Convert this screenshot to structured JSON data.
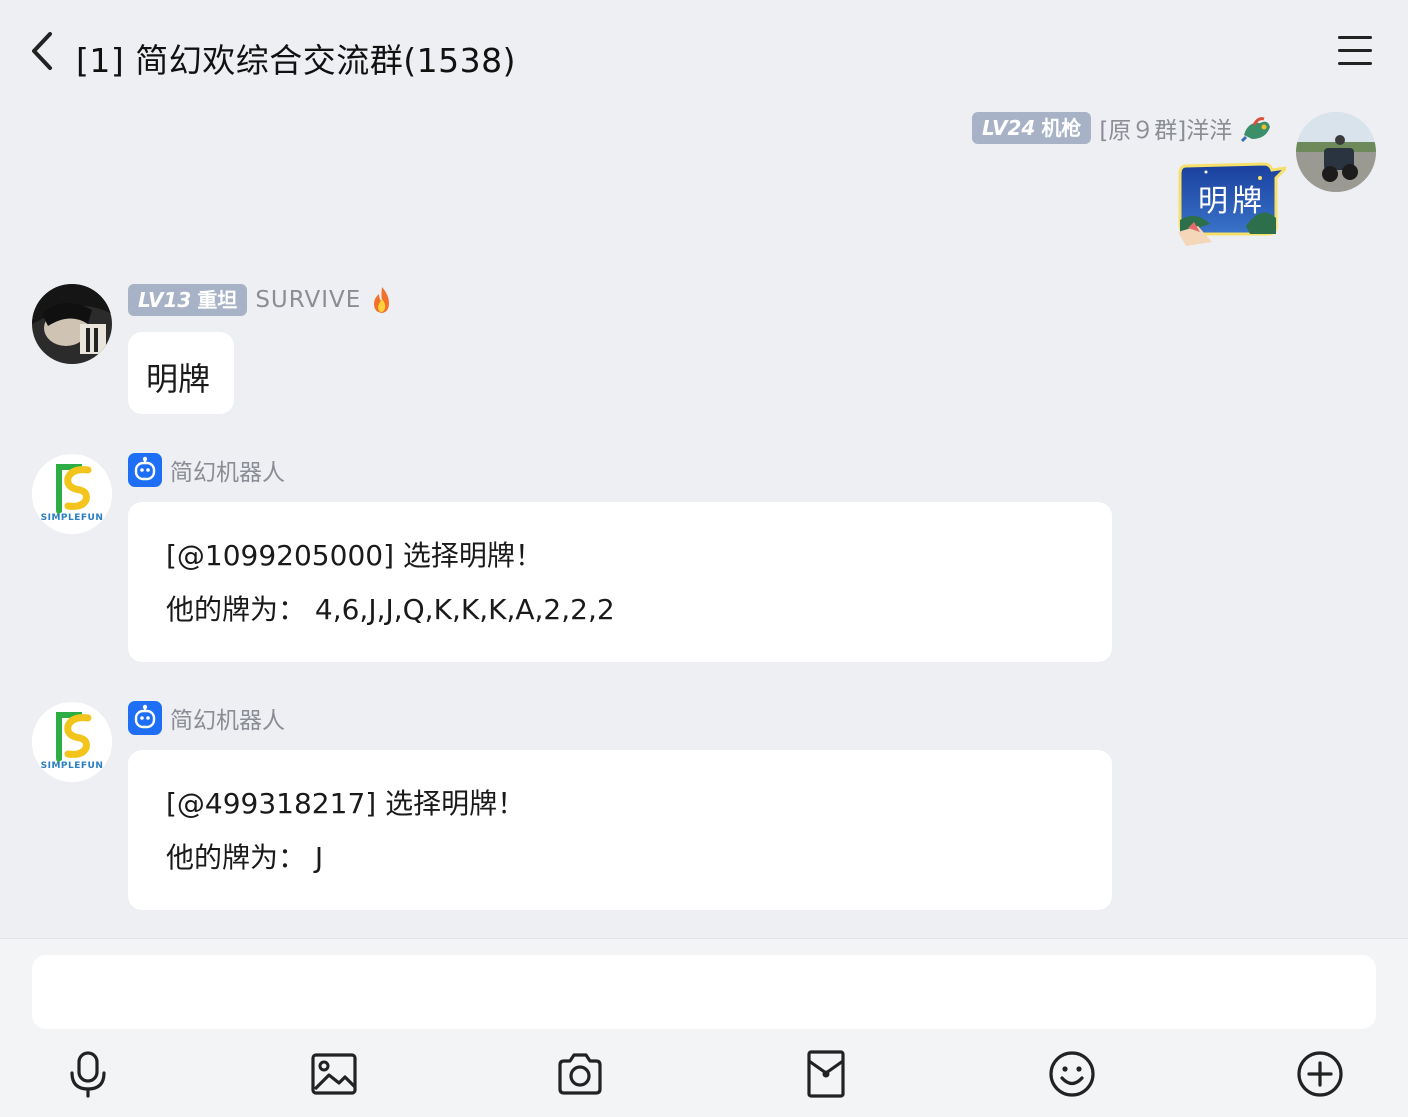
{
  "header": {
    "title": "[1] 简幻欢综合交流群(1538)"
  },
  "messages": [
    {
      "side": "right",
      "level": "LV24",
      "title": "机枪",
      "name": "[原９群]洋洋",
      "sticker_text": "明牌"
    },
    {
      "side": "left",
      "level": "LV13",
      "title": "重坦",
      "name": "SURVIVE",
      "text": "明牌"
    },
    {
      "side": "left",
      "name": "简幻机器人",
      "avatar_text": "SIMPLEFUN",
      "lines": [
        "[@1099205000] 选择明牌！",
        "他的牌为：  4,6,J,J,Q,K,K,K,A,2,2,2"
      ]
    },
    {
      "side": "left",
      "name": "简幻机器人",
      "avatar_text": "SIMPLEFUN",
      "lines": [
        "[@499318217] 选择明牌！",
        "他的牌为：  J"
      ]
    }
  ],
  "input": {
    "placeholder": ""
  },
  "toolbar": [
    "mic-icon",
    "image-icon",
    "camera-icon",
    "red-packet-icon",
    "emoji-icon",
    "plus-icon"
  ],
  "colors": {
    "background": "#eeeff3",
    "badge": "#a7b2c6",
    "bot_blue": "#1e6ff5",
    "logo_green": "#2dae45",
    "logo_yellow": "#f2c41c"
  }
}
